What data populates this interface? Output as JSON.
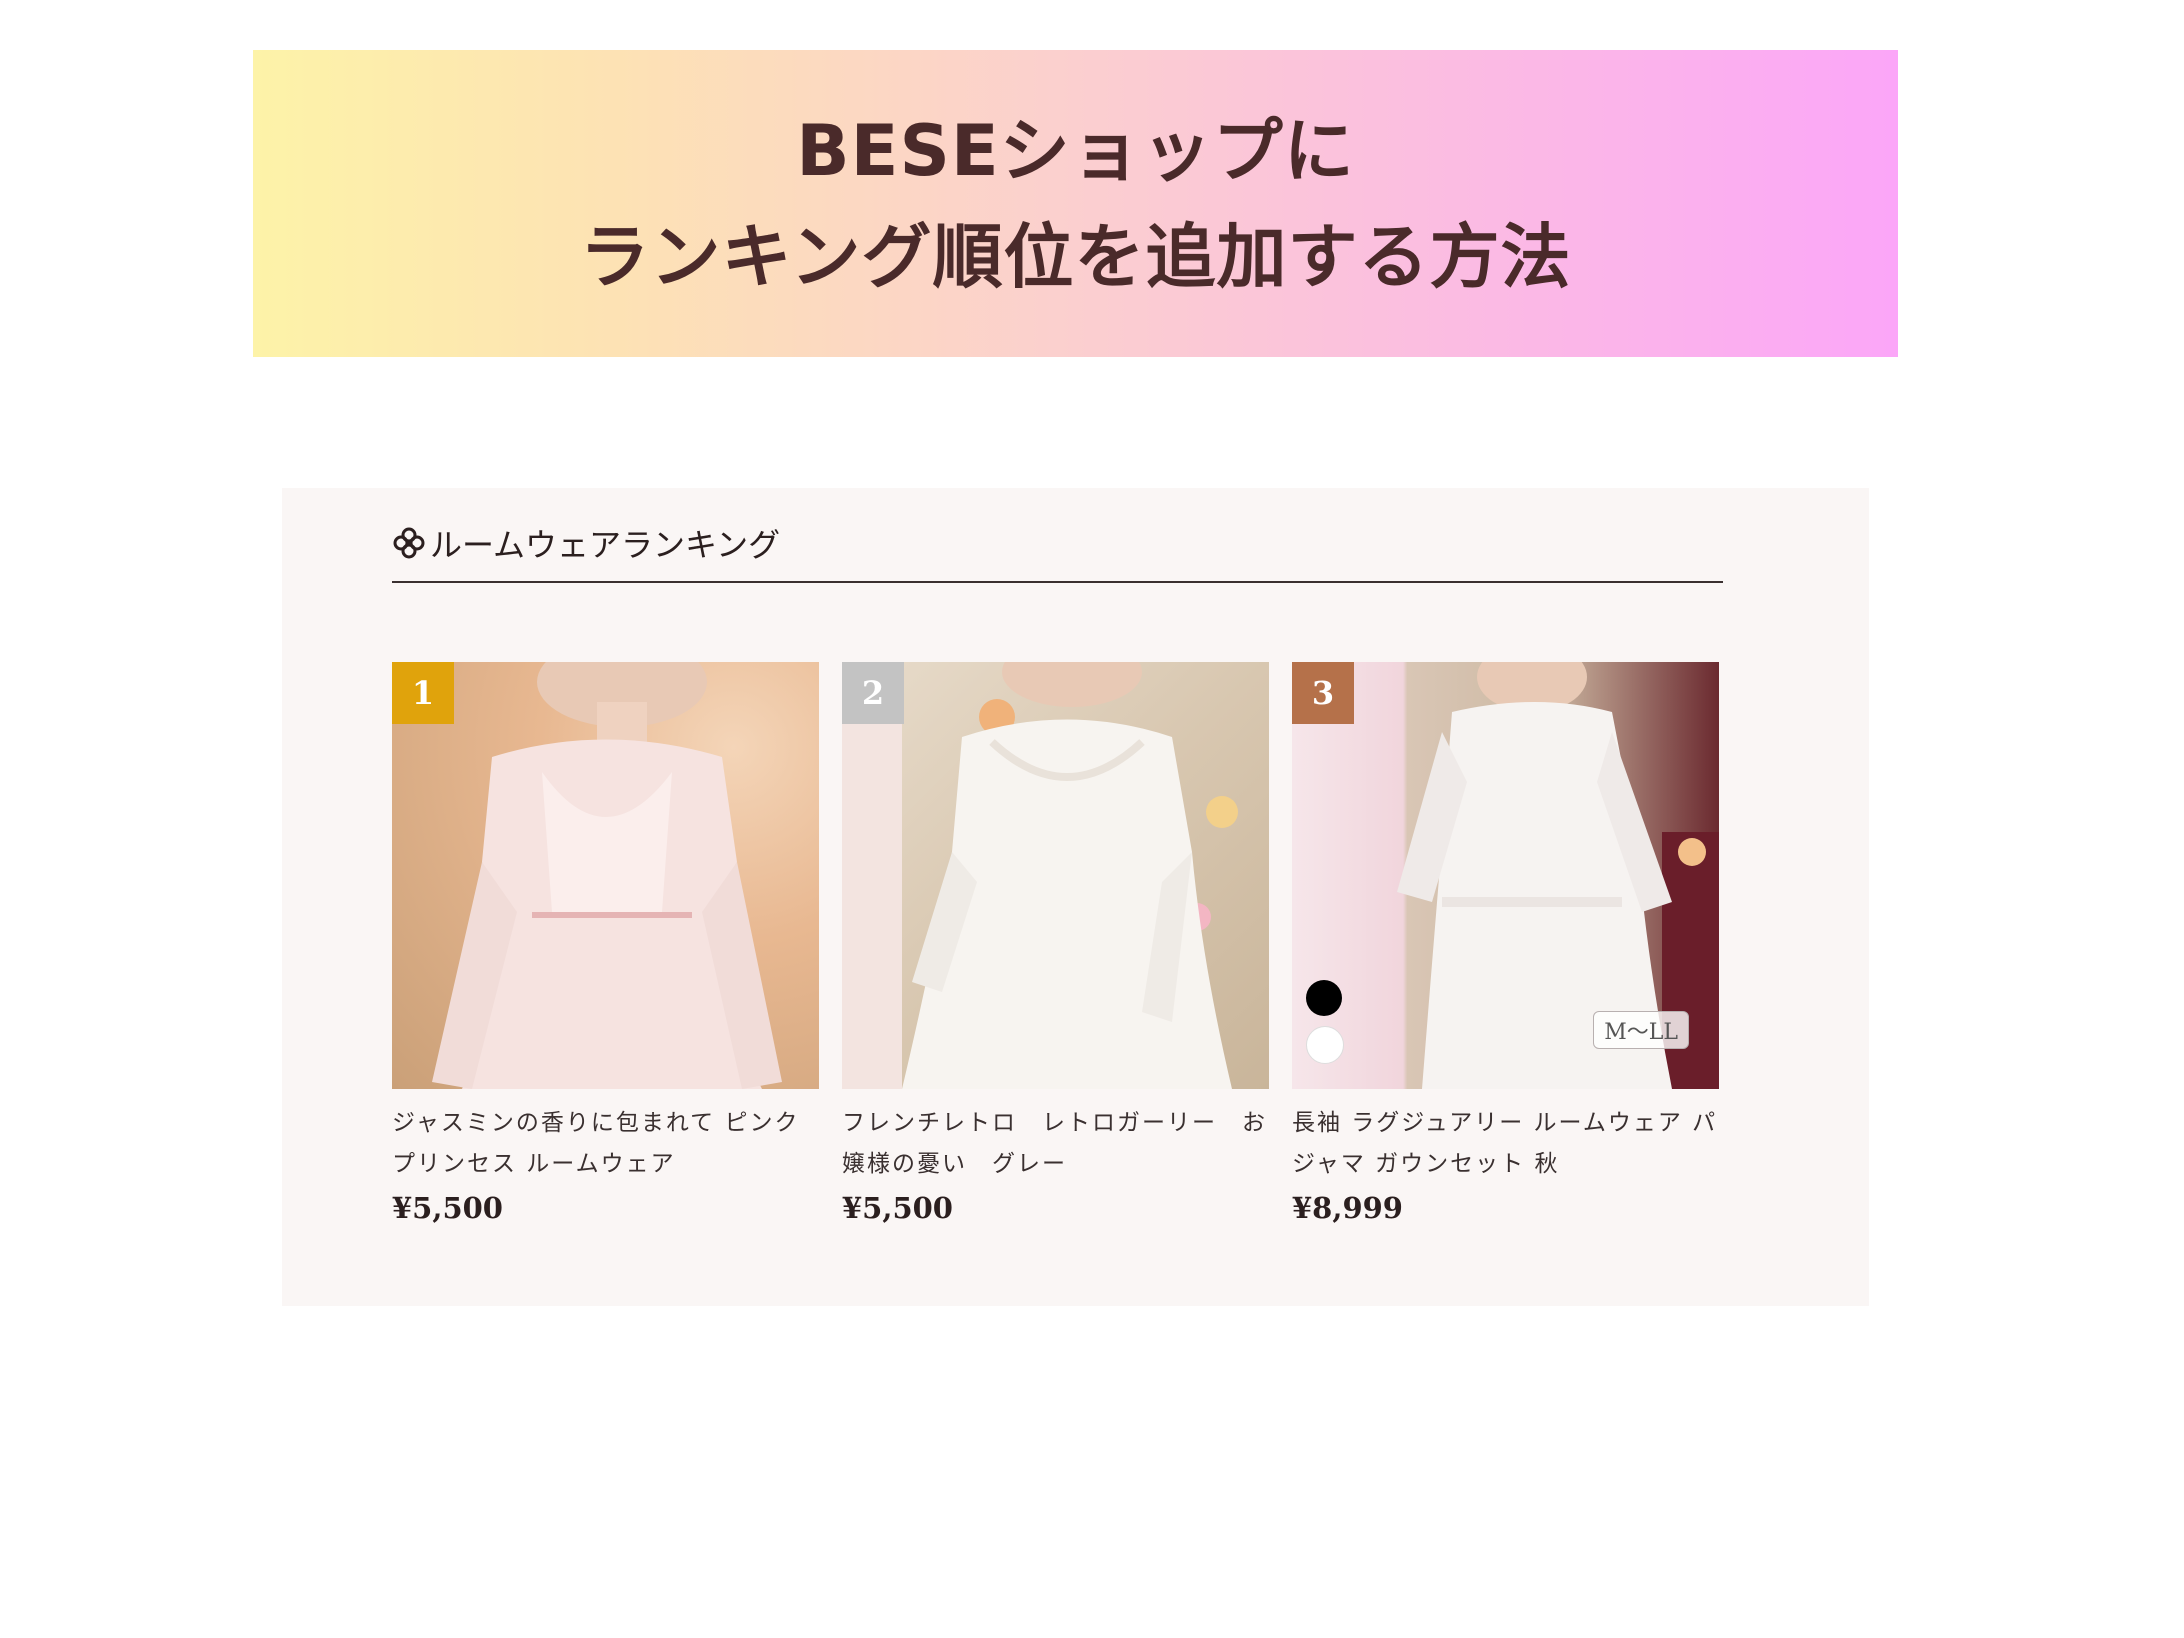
{
  "banner": {
    "line1": "BESEショップに",
    "line2": "ランキング順位を追加する方法"
  },
  "section": {
    "icon": "flower-icon",
    "title": "ルームウェアランキング"
  },
  "products": [
    {
      "rank": "1",
      "name": "ジャスミンの香りに包まれて ピンクプリンセス ルームウェア",
      "price": "¥5,500",
      "badge_color": "#e0a30c"
    },
    {
      "rank": "2",
      "name": "フレンチレトロ　レトロガーリー　お嬢様の憂い　グレー",
      "price": "¥5,500",
      "badge_color": "#c3c3c3"
    },
    {
      "rank": "3",
      "name": "長袖 ラグジュアリー ルームウェア パジャマ ガウンセット 秋",
      "price": "¥8,999",
      "badge_color": "#b5714a",
      "size_tag": "M〜LL"
    }
  ]
}
